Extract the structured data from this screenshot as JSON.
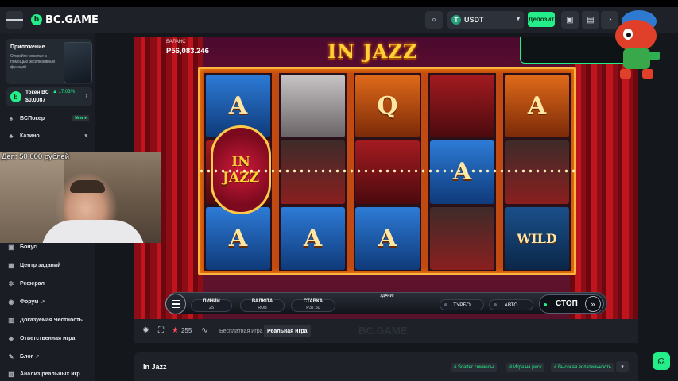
{
  "header": {
    "brand": "BC.GAME",
    "currency": "USDT",
    "currency_icon": "tether-icon",
    "deposit_label": "Депозит"
  },
  "sidebar": {
    "promo": {
      "title": "Приложение",
      "text": "Откройте веселье с помощью эксклюзивных функций"
    },
    "token": {
      "name": "Токен BC",
      "change": "17.03%",
      "price": "$0.0087"
    },
    "items": [
      {
        "label": "BCПокер",
        "badge": "New ●",
        "icon": "poker-icon"
      },
      {
        "label": "Казино",
        "icon": "casino-icon"
      },
      {
        "label": "Бонус",
        "icon": "gift-icon"
      },
      {
        "label": "Центр заданий",
        "icon": "tasks-icon"
      },
      {
        "label": "Реферал",
        "icon": "referral-icon"
      },
      {
        "label": "Форум",
        "icon": "forum-icon"
      },
      {
        "label": "Доказуемая Честность",
        "icon": "fairness-icon"
      },
      {
        "label": "Ответственная игра",
        "icon": "responsible-icon"
      },
      {
        "label": "Блог",
        "icon": "blog-icon"
      },
      {
        "label": "Анализ реальных игр",
        "icon": "analysis-icon"
      }
    ]
  },
  "webcam": {
    "caption": "Деп: 50 000 рублей"
  },
  "game": {
    "title": "IN JAZZ",
    "balance_label": "БАЛАНС",
    "balance_value": "P56,083.246",
    "logo_line1": "IN",
    "logo_line2": "JAZZ",
    "reels": [
      [
        "A",
        "",
        "A"
      ],
      [
        "",
        "",
        "A"
      ],
      [
        "Q",
        "",
        "A"
      ],
      [
        "",
        "A",
        ""
      ],
      [
        "A",
        "",
        "WILD"
      ]
    ],
    "controls": {
      "lines_label": "ЛИНИИ",
      "lines_value": "25",
      "currency_label": "ВАЛЮТА",
      "currency_value": "RUB",
      "bet_label": "СТАВКА",
      "bet_value": "P37.50",
      "win_label": "УДАЧИ!",
      "turbo_label": "ТУРБО",
      "auto_label": "АВТО",
      "stop_label": "СТОП"
    }
  },
  "game_bar": {
    "favorites": "255",
    "free_play": "Бесплатная игра",
    "real_play": "Реальная игра",
    "watermark": "BC.GAME"
  },
  "info": {
    "title": "In Jazz",
    "tags": [
      "# Scatter символы",
      "# Игра на риск",
      "# Высокая волатильность"
    ]
  },
  "colors": {
    "accent": "#24ee89",
    "background": "#14171c",
    "panel": "#1e2228"
  }
}
